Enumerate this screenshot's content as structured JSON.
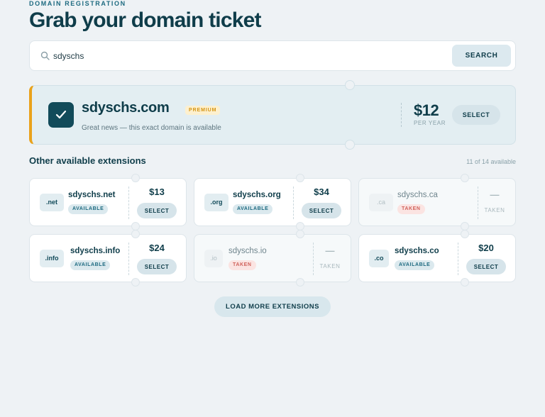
{
  "header": {
    "eyebrow": "DOMAIN REGISTRATION",
    "title": "Grab your domain ticket"
  },
  "search": {
    "value": "sdyschs",
    "placeholder": "",
    "button_label": "SEARCH"
  },
  "featured": {
    "domain": "sdyschs.com",
    "badge": "PREMIUM",
    "subtitle": "Great news — this exact domain is available",
    "price": "$12",
    "period": "PER YEAR",
    "select_label": "SELECT"
  },
  "extensions": {
    "heading": "Other available extensions",
    "count": "11 of 14 available",
    "items": [
      {
        "tld": ".net",
        "name": "sdyschs.net",
        "status": "AVAILABLE",
        "price": "$13",
        "action": "SELECT"
      },
      {
        "tld": ".org",
        "name": "sdyschs.org",
        "status": "AVAILABLE",
        "price": "$34",
        "action": "SELECT"
      },
      {
        "tld": ".ca",
        "name": "sdyschs.ca",
        "status": "TAKEN",
        "price": "—",
        "action": "TAKEN"
      },
      {
        "tld": ".info",
        "name": "sdyschs.info",
        "status": "AVAILABLE",
        "price": "$24",
        "action": "SELECT"
      },
      {
        "tld": ".io",
        "name": "sdyschs.io",
        "status": "TAKEN",
        "price": "—",
        "action": "TAKEN"
      },
      {
        "tld": ".co",
        "name": "sdyschs.co",
        "status": "AVAILABLE",
        "price": "$20",
        "action": "SELECT"
      }
    ]
  },
  "load_more_label": "LOAD MORE EXTENSIONS",
  "colors": {
    "accent": "#e9a21b",
    "primary": "#124b5a",
    "taken": "#d0625b"
  }
}
